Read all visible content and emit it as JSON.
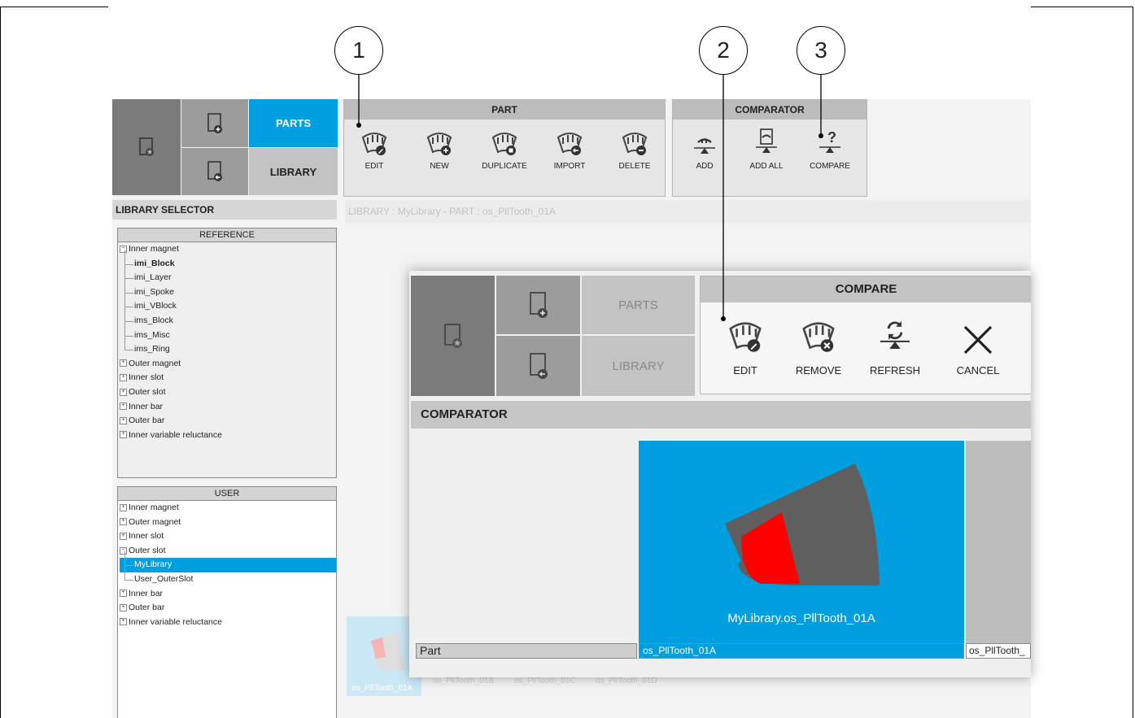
{
  "callouts": [
    "1",
    "2",
    "3"
  ],
  "tabs": {
    "parts": "PARTS",
    "library": "LIBRARY"
  },
  "part_group": {
    "title": "PART",
    "tools": [
      {
        "label": "EDIT",
        "icon": "tooth-edit-icon"
      },
      {
        "label": "NEW",
        "icon": "tooth-new-icon"
      },
      {
        "label": "DUPLICATE",
        "icon": "tooth-duplicate-icon"
      },
      {
        "label": "IMPORT",
        "icon": "tooth-import-icon"
      },
      {
        "label": "DELETE",
        "icon": "tooth-delete-icon"
      }
    ]
  },
  "comparator_group": {
    "title": "COMPARATOR",
    "tools": [
      {
        "label": "ADD",
        "icon": "scale-add-icon"
      },
      {
        "label": "ADD ALL",
        "icon": "scale-add-all-icon"
      },
      {
        "label": "COMPARE",
        "icon": "scale-compare-icon"
      }
    ]
  },
  "library_selector": {
    "title": "LIBRARY SELECTOR",
    "reference": {
      "title": "REFERENCE",
      "open_node": "Inner magnet",
      "children": [
        "imi_Block",
        "imi_Layer",
        "imi_Spoke",
        "imi_VBlock",
        "ims_Block",
        "ims_Misc",
        "ims_Ring"
      ],
      "bold_child": "imi_Block",
      "closed_nodes": [
        "Outer magnet",
        "Inner slot",
        "Outer slot",
        "Inner bar",
        "Outer bar",
        "Inner variable reluctance"
      ]
    },
    "user": {
      "title": "USER",
      "before_nodes": [
        "Inner magnet",
        "Outer magnet",
        "Inner slot"
      ],
      "open_node": "Outer slot",
      "children": [
        "MyLibrary",
        "User_OuterSlot"
      ],
      "selected_child": "MyLibrary",
      "after_nodes": [
        "Inner bar",
        "Outer bar",
        "Inner variable reluctance"
      ]
    }
  },
  "breadcrumb": "LIBRARY : MyLibrary   -   PART : os_PllTooth_01A",
  "thumbnails": [
    "os_PllTooth_01A",
    "os_PllTooth_01B",
    "os_PllTooth_01C",
    "os_PllTooth_01D"
  ],
  "compare_window": {
    "tabs": {
      "parts": "PARTS",
      "library": "LIBRARY"
    },
    "group_title": "COMPARE",
    "tools": [
      {
        "label": "EDIT",
        "icon": "tooth-edit-icon"
      },
      {
        "label": "REMOVE",
        "icon": "tooth-remove-icon"
      },
      {
        "label": "REFRESH",
        "icon": "refresh-icon"
      },
      {
        "label": "CANCEL",
        "icon": "close-icon"
      }
    ],
    "comparator_title": "COMPARATOR",
    "card_caption": "MyLibrary.os_PllTooth_01A",
    "row_label": "Part",
    "cells": [
      "os_PllTooth_01A",
      "os_PllTooth_"
    ]
  },
  "colors": {
    "accent": "#009fdf",
    "dark_tile": "#7b7b7b",
    "magnet_red": "#ff0000",
    "part_grey": "#5f5f5f"
  }
}
